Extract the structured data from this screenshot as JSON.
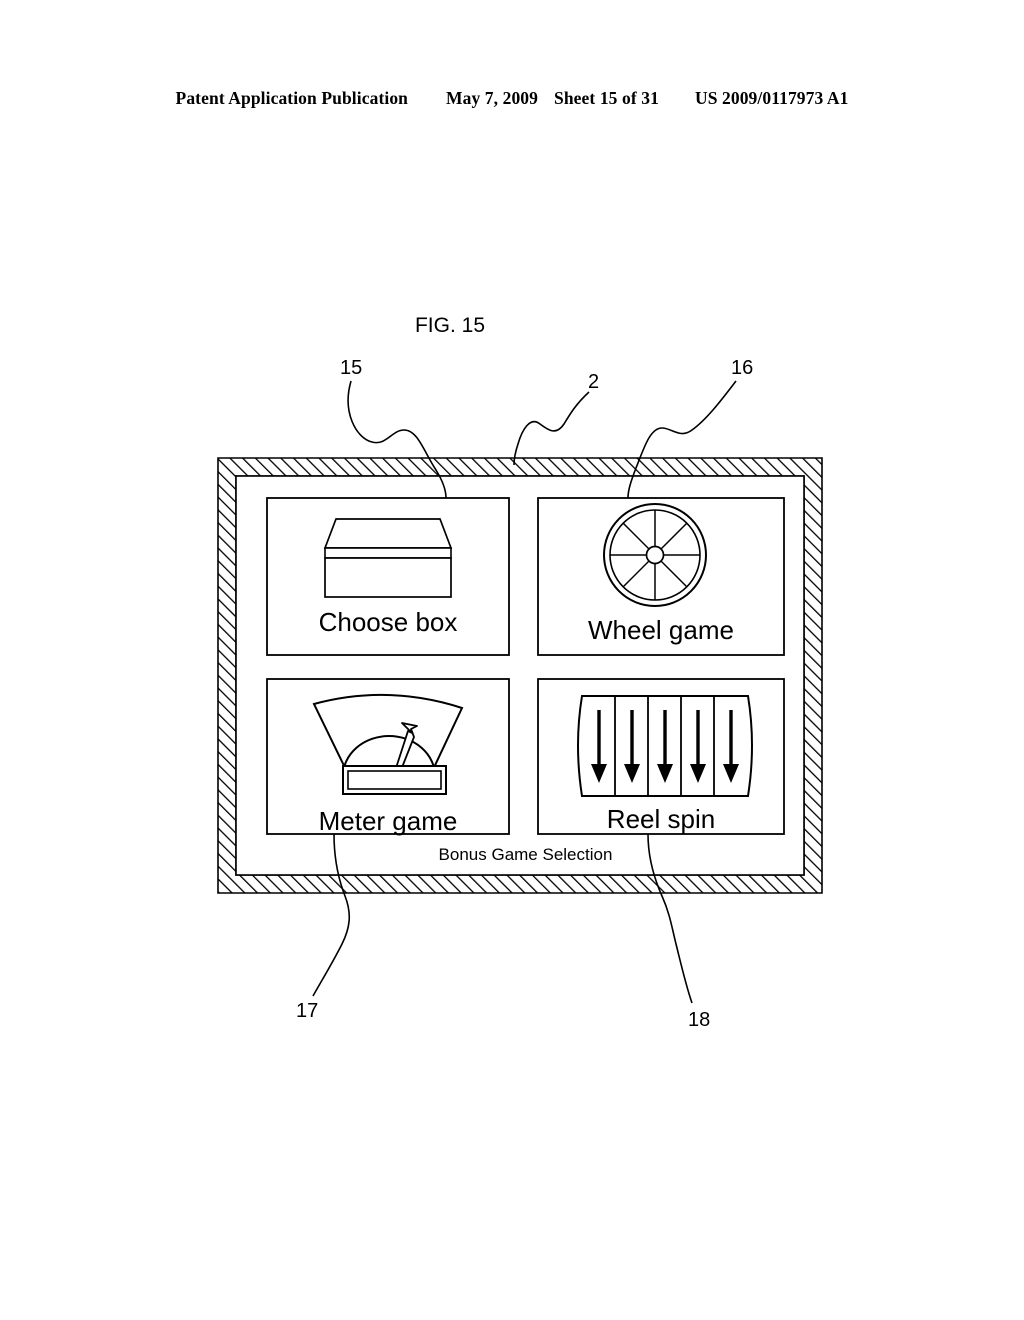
{
  "header": {
    "publication": "Patent Application Publication",
    "date": "May 7, 2009",
    "sheet": "Sheet 15 of 31",
    "doc_number": "US 2009/0117973 A1"
  },
  "figure": {
    "label": "FIG. 15",
    "screen_caption": "Bonus Game Selection",
    "reference_numerals": [
      {
        "id": "15",
        "label": "15",
        "points_to": "choose-box-tile"
      },
      {
        "id": "2",
        "label": "2",
        "points_to": "display-frame"
      },
      {
        "id": "16",
        "label": "16",
        "points_to": "wheel-game-tile"
      },
      {
        "id": "17",
        "label": "17",
        "points_to": "meter-game-tile"
      },
      {
        "id": "18",
        "label": "18",
        "points_to": "reel-spin-tile"
      }
    ],
    "tiles": [
      {
        "id": "choose-box",
        "caption": "Choose box",
        "icon": "gift-box-icon"
      },
      {
        "id": "wheel-game",
        "caption": "Wheel game",
        "icon": "spoked-wheel-icon"
      },
      {
        "id": "meter-game",
        "caption": "Meter game",
        "icon": "gauge-meter-icon"
      },
      {
        "id": "reel-spin",
        "caption": "Reel spin",
        "icon": "five-reel-down-arrows-icon"
      }
    ]
  },
  "style": {
    "ink": "#000000",
    "paper": "#ffffff"
  }
}
